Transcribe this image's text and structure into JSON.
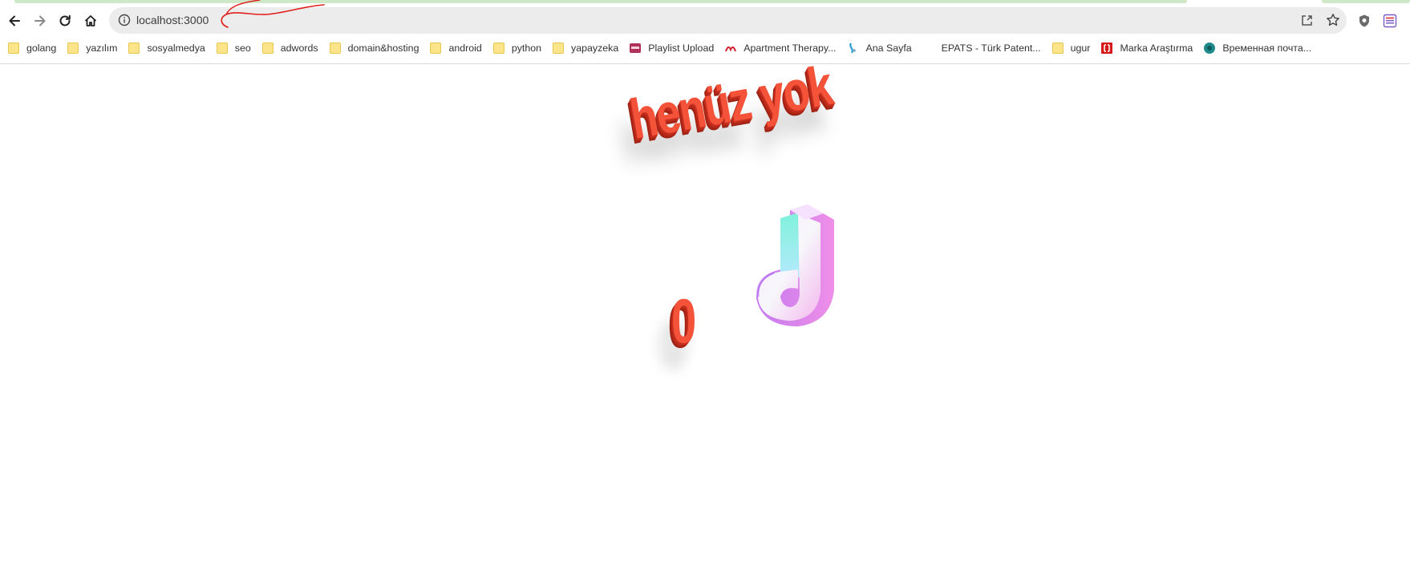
{
  "browser": {
    "url": "localhost:3000",
    "bookmarks": [
      {
        "label": "golang",
        "icon": "folder-icon"
      },
      {
        "label": "yazılım",
        "icon": "folder-icon"
      },
      {
        "label": "sosyalmedya",
        "icon": "folder-icon"
      },
      {
        "label": "seo",
        "icon": "folder-icon"
      },
      {
        "label": "adwords",
        "icon": "folder-icon"
      },
      {
        "label": "domain&hosting",
        "icon": "folder-icon"
      },
      {
        "label": "android",
        "icon": "folder-icon"
      },
      {
        "label": "python",
        "icon": "folder-icon"
      },
      {
        "label": "yapayzeka",
        "icon": "folder-icon"
      },
      {
        "label": "Playlist Upload",
        "icon": "playlist-favicon"
      },
      {
        "label": "Apartment Therapy...",
        "icon": "apartment-therapy-favicon"
      },
      {
        "label": "Ana Sayfa",
        "icon": "ana-sayfa-favicon"
      },
      {
        "label": "EPATS - Türk Patent...",
        "icon": "epats-favicon"
      },
      {
        "label": "ugur",
        "icon": "folder-icon"
      },
      {
        "label": "Marka Araştırma",
        "icon": "marka-favicon"
      },
      {
        "label": "Временная почта...",
        "icon": "temp-mail-favicon"
      }
    ]
  },
  "page": {
    "heading": "henüz yok",
    "count": "0",
    "icon": "tiktok-note-icon"
  },
  "colors": {
    "accent_red": "#f4533a",
    "annotation_red": "#e0201b",
    "load_strip": "#cfe8c7"
  }
}
